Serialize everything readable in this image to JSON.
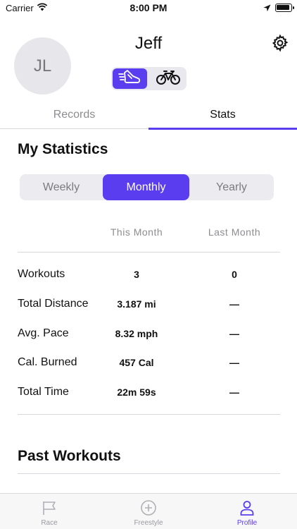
{
  "status_bar": {
    "carrier": "Carrier",
    "time": "8:00 PM"
  },
  "profile": {
    "initials": "JL",
    "name": "Jeff"
  },
  "modes": {
    "selected": "run",
    "items": [
      "run-shoe-icon",
      "bicycle-icon"
    ]
  },
  "tabs": {
    "records": "Records",
    "stats": "Stats",
    "active": "Stats"
  },
  "statistics": {
    "title": "My Statistics",
    "periods": [
      "Weekly",
      "Monthly",
      "Yearly"
    ],
    "selected_period": "Monthly",
    "columns": {
      "this": "This Month",
      "last": "Last Month"
    },
    "rows": [
      {
        "label": "Workouts",
        "this": "3",
        "last": "0"
      },
      {
        "label": "Total Distance",
        "this": "3.187 mi",
        "last": "—"
      },
      {
        "label": "Avg. Pace",
        "this": "8.32 mph",
        "last": "—"
      },
      {
        "label": "Cal. Burned",
        "this": "457 Cal",
        "last": "—"
      },
      {
        "label": "Total Time",
        "this": "22m 59s",
        "last": "—"
      }
    ]
  },
  "past_workouts": {
    "title": "Past Workouts"
  },
  "tab_bar": {
    "items": [
      {
        "label": "Race",
        "icon": "flag-icon"
      },
      {
        "label": "Freestyle",
        "icon": "plus-circle-icon"
      },
      {
        "label": "Profile",
        "icon": "person-icon"
      }
    ],
    "active": "Profile"
  },
  "colors": {
    "accent": "#5b3df0",
    "muted": "#8c8c92"
  }
}
